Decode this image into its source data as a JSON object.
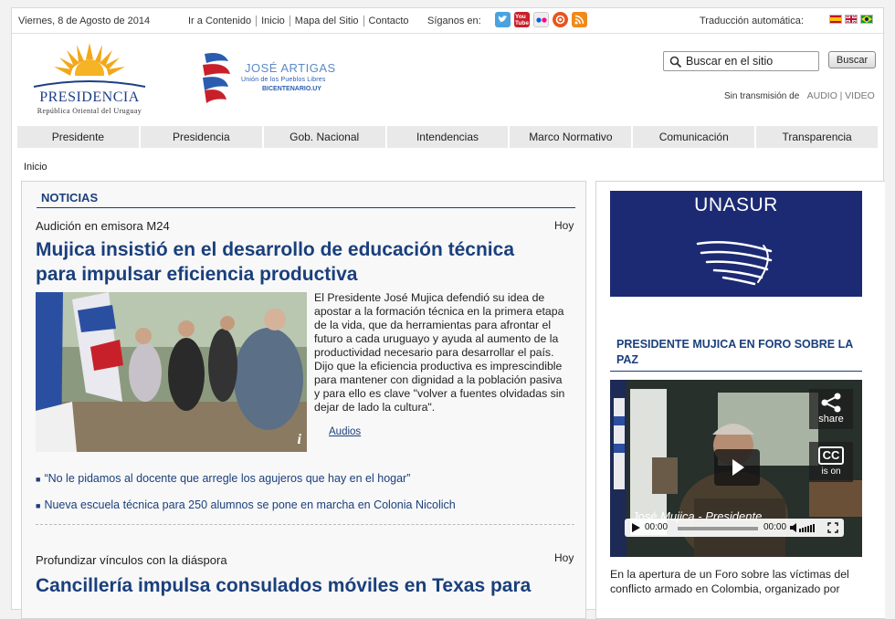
{
  "topbar": {
    "date": "Viernes, 8 de Agosto de 2014",
    "links": [
      "Ir a Contenido",
      "Inicio",
      "Mapa del Sitio",
      "Contacto"
    ],
    "follow_label": "Síganos en:",
    "social": [
      {
        "icon": "twitter-icon",
        "color": "#4aa3df",
        "glyph": "t"
      },
      {
        "icon": "youtube-icon",
        "color": "#c8202a",
        "glyph": "You"
      },
      {
        "icon": "flickr-icon",
        "color": "#e8e8e8",
        "glyph": "●●"
      },
      {
        "icon": "radio-icon",
        "color": "#e8551e",
        "glyph": "◉"
      },
      {
        "icon": "rss-icon",
        "color": "#f08a1c",
        "glyph": ")))"
      }
    ],
    "translate_label": "Traducción automática:"
  },
  "header": {
    "logo_title": "PRESIDENCIA",
    "logo_subtitle": "República Oriental del Uruguay",
    "artigas_title": "JOSÉ ARTIGAS",
    "artigas_sub": "Unión de los Pueblos Libres",
    "artigas_site": "BICENTENARIO.UY",
    "search_value": "Buscar en el sitio",
    "search_button": "Buscar",
    "transmission_label": "Sin transmisión de",
    "audio_label": "AUDIO",
    "video_label": "VIDEO"
  },
  "nav": [
    "Presidente",
    "Presidencia",
    "Gob. Nacional",
    "Intendencias",
    "Marco Normativo",
    "Comunicación",
    "Transparencia"
  ],
  "breadcrumb": "Inicio",
  "news": {
    "heading": "NOTICIAS",
    "item1": {
      "kicker": "Audición en emisora M24",
      "date": "Hoy",
      "headline_line1": "Mujica insistió en el desarrollo de educación técnica",
      "headline_line2": "para impulsar eficiencia productiva",
      "lead": "El Presidente José Mujica defendió su idea de apostar a la formación técnica en la primera etapa de la vida, que da herramientas para afrontar el futuro a cada uruguayo y ayuda al aumento de la productividad necesario para desarrollar el país. Dijo que la eficiencia productiva es imprescindible para mantener con dignidad a la población pasiva y para ello es clave \"volver a fuentes olvidadas sin dejar de lado la cultura\".",
      "audios_link": "Audios",
      "related": [
        "“No le pidamos al docente que arregle los agujeros que hay en el hogar”",
        "Nueva escuela técnica para 250 alumnos se pone en marcha en Colonia Nicolich"
      ]
    },
    "item2": {
      "kicker": "Profundizar vínculos con la diáspora",
      "date": "Hoy",
      "headline": "Cancillería impulsa consulados móviles en Texas para"
    }
  },
  "sidebar": {
    "banner_text": "UNASUR",
    "video_heading": "PRESIDENTE MUJICA EN FORO SOBRE LA PAZ",
    "video": {
      "share_label": "share",
      "cc_label": "CC",
      "cc_state": "is on",
      "time_current": "00:00",
      "time_total": "00:00"
    },
    "caption": "En la apertura de un Foro sobre las víctimas del conflicto armado en Colombia, organizado por"
  }
}
